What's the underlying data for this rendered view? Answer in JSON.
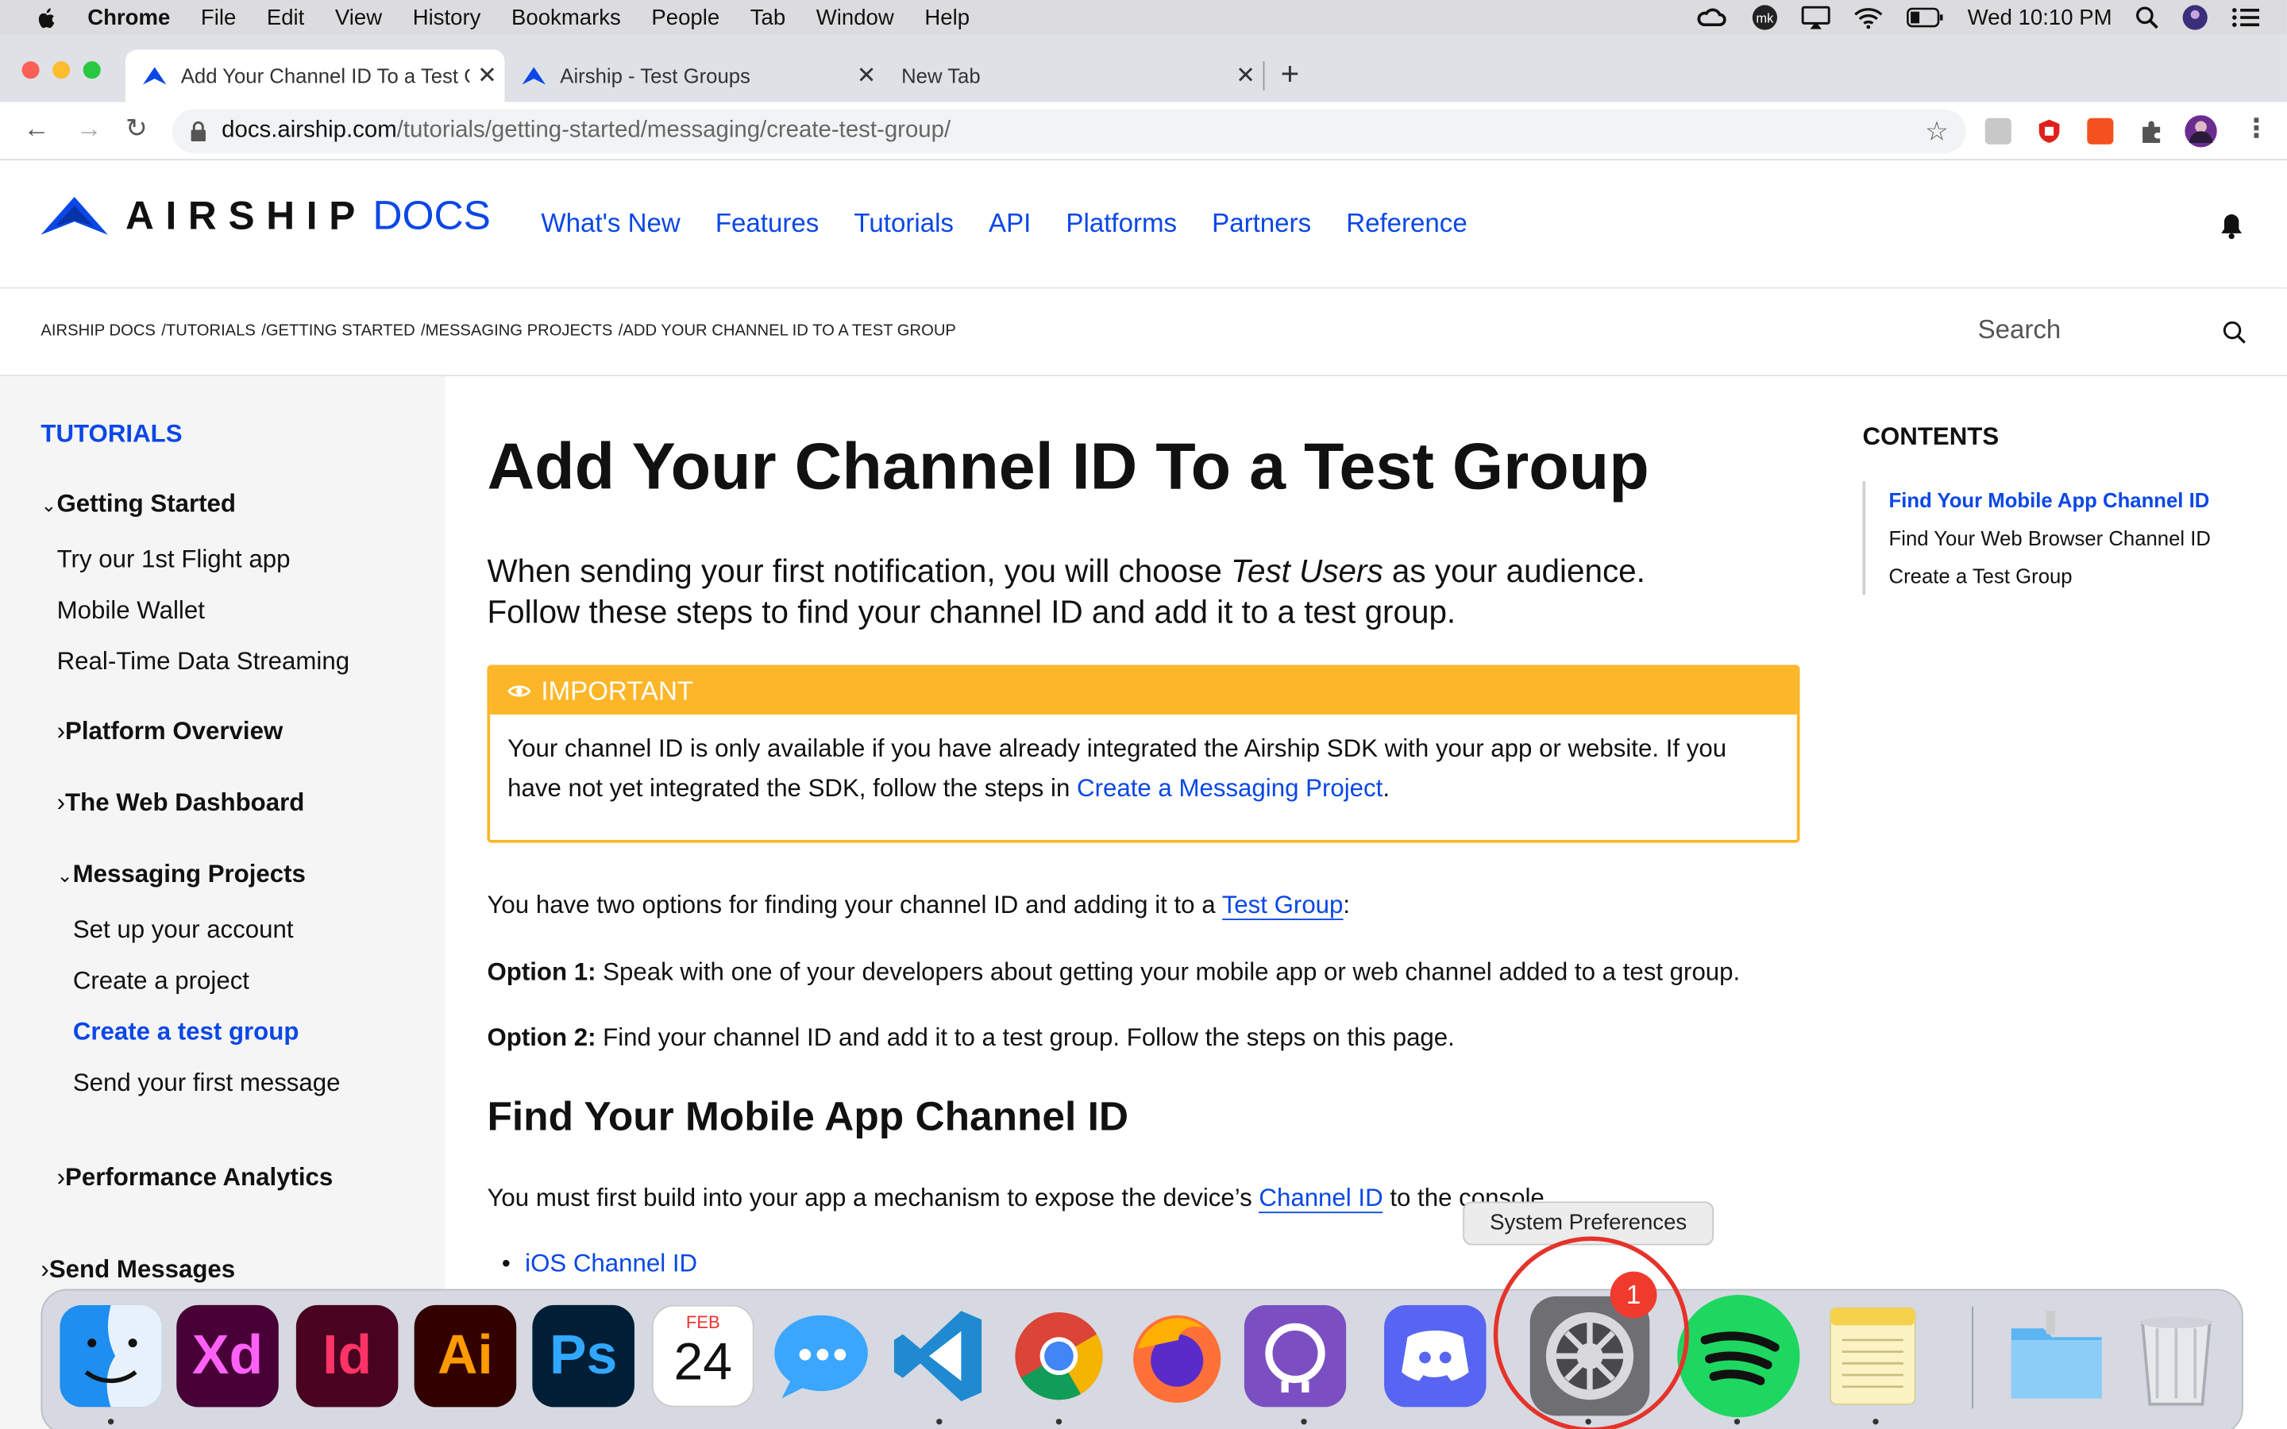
{
  "menubar": {
    "app": "Chrome",
    "items": [
      "File",
      "Edit",
      "View",
      "History",
      "Bookmarks",
      "People",
      "Tab",
      "Window",
      "Help"
    ],
    "clock": "Wed 10:10 PM"
  },
  "tabs": [
    {
      "title": "Add Your Channel ID To a Test Group",
      "active": true
    },
    {
      "title": "Airship - Test Groups",
      "active": false
    },
    {
      "title": "New Tab",
      "active": false
    }
  ],
  "address": {
    "host": "docs.airship.com",
    "path": "/tutorials/getting-started/messaging/create-test-group/"
  },
  "site": {
    "logo_word": "AIRSHIP",
    "logo_docs": "DOCS",
    "nav": [
      "What's New",
      "Features",
      "Tutorials",
      "API",
      "Platforms",
      "Partners",
      "Reference"
    ]
  },
  "breadcrumb": [
    "AIRSHIP DOCS",
    "/TUTORIALS",
    "/GETTING STARTED",
    "/MESSAGING PROJECTS",
    "/ADD YOUR CHANNEL ID TO A TEST GROUP"
  ],
  "search": {
    "placeholder": "Search"
  },
  "sidebar": {
    "heading": "TUTORIALS",
    "getting_started": "Getting Started",
    "gs_items": [
      "Try our 1st Flight app",
      "Mobile Wallet",
      "Real-Time Data Streaming"
    ],
    "platform_overview": "Platform Overview",
    "web_dashboard": "The Web Dashboard",
    "messaging_projects": "Messaging Projects",
    "mp_items": [
      "Set up your account",
      "Create a project",
      "Create a test group",
      "Send your first message"
    ],
    "performance_analytics": "Performance Analytics",
    "send_messages": "Send Messages"
  },
  "article": {
    "title": "Add Your Channel ID To a Test Group",
    "lead_1": "When sending your first notification, you will choose ",
    "lead_em": "Test Users",
    "lead_2": " as your audience.",
    "lead_3": "Follow these steps to find your channel ID and add it to a test group.",
    "callout_label": "IMPORTANT",
    "callout_text_1": "Your channel ID is only available if you have already integrated the Airship SDK with your app or website. If you have not yet integrated the SDK, follow the steps in ",
    "callout_link": "Create a Messaging Project",
    "callout_text_2": ".",
    "options_intro": "You have two options for finding your channel ID and adding it to a ",
    "options_link": "Test Group",
    "options_colon": ":",
    "opt1_label": "Option 1:",
    "opt1_text": " Speak with one of your developers about getting your mobile app or web channel added to a test group.",
    "opt2_label": "Option 2:",
    "opt2_text": " Find your channel ID and add it to a test group. Follow the steps on this page.",
    "h2": "Find Your Mobile App Channel ID",
    "p_build_1": "You must first build into your app a mechanism to expose the device’s ",
    "p_build_link": "Channel ID",
    "p_build_2": " to the console.",
    "bullet_ios": "iOS Channel ID"
  },
  "toc": {
    "heading": "CONTENTS",
    "items": [
      "Find Your Mobile App Channel ID",
      "Find Your Web Browser Channel ID",
      "Create a Test Group"
    ]
  },
  "dock": {
    "tooltip": "System Preferences",
    "badge": "1",
    "calendar_month": "FEB",
    "calendar_day": "24",
    "xd": "Xd",
    "id": "Id",
    "ai": "Ai",
    "ps": "Ps"
  },
  "colors": {
    "brand_blue": "#0a47e6",
    "callout_amber": "#fdb628"
  }
}
